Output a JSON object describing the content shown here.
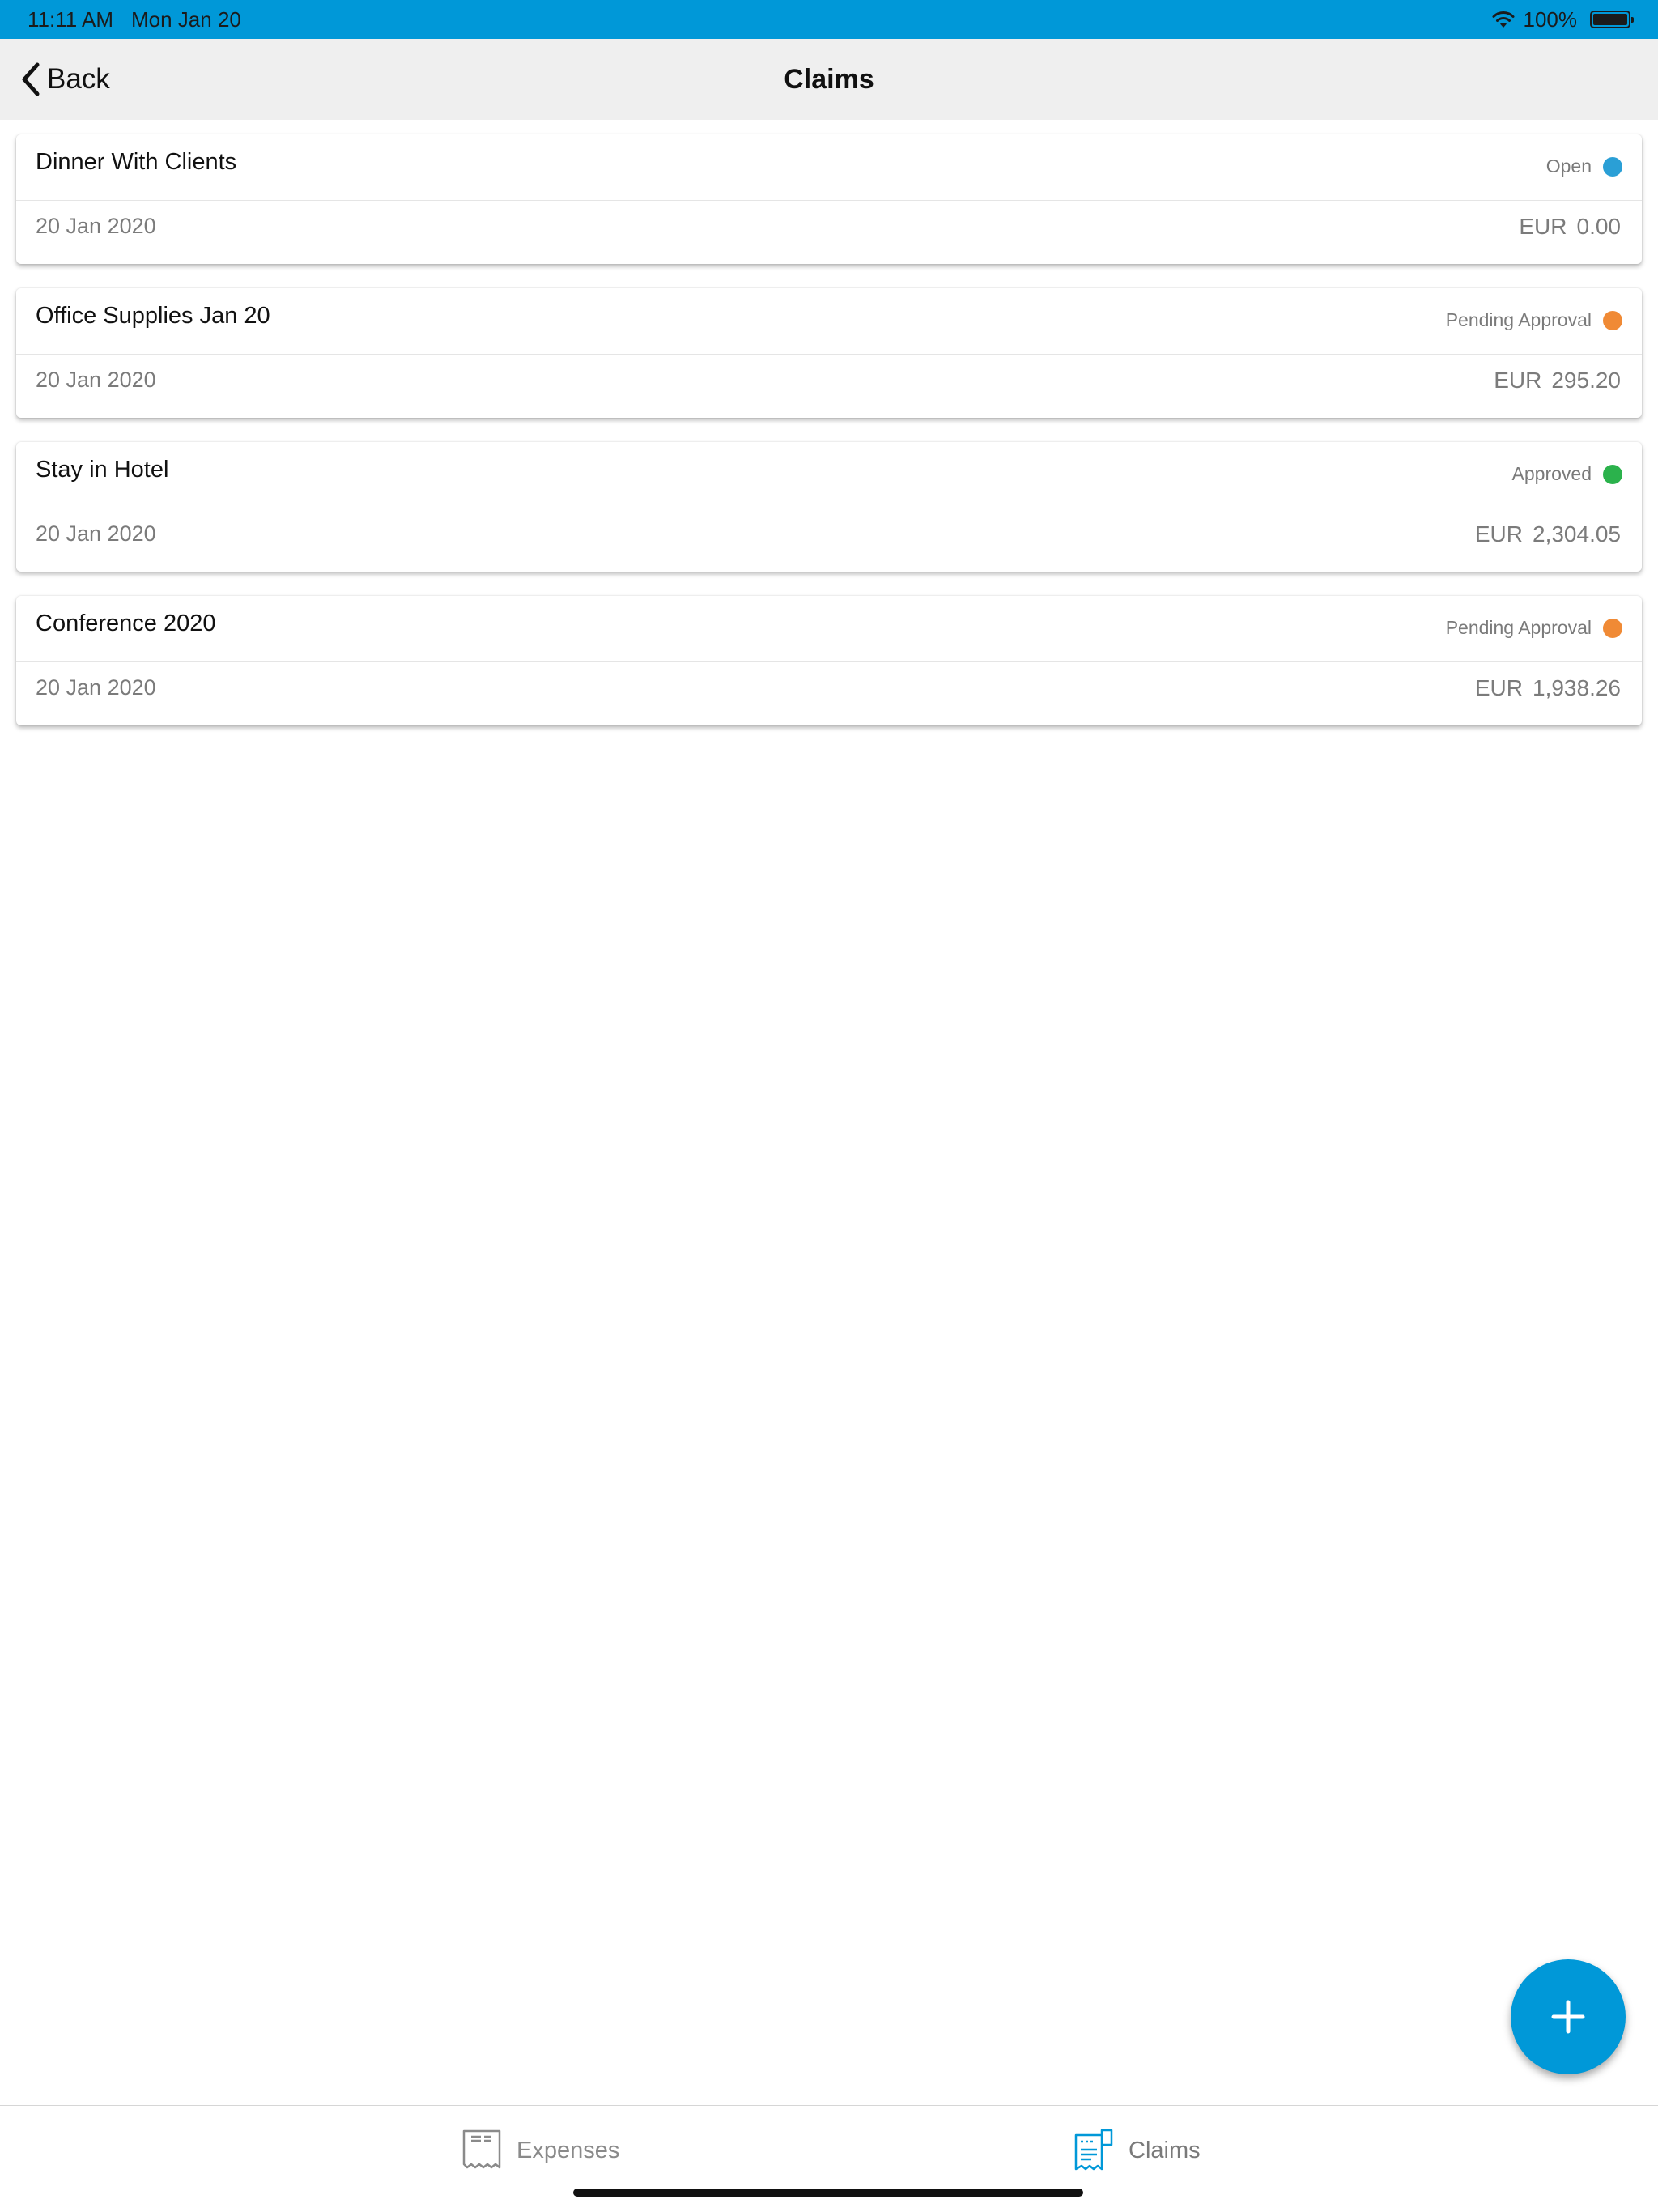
{
  "status_bar": {
    "time": "11:11 AM",
    "date": "Mon Jan 20",
    "battery_percent": "100%",
    "battery_level": 1.0
  },
  "nav": {
    "back_label": "Back",
    "title": "Claims"
  },
  "claims": [
    {
      "title": "Dinner With Clients",
      "status": "Open",
      "status_color": "#2a9fd6",
      "date": "20 Jan 2020",
      "currency": "EUR",
      "amount": "0.00"
    },
    {
      "title": "Office Supplies Jan 20",
      "status": "Pending Approval",
      "status_color": "#f08a35",
      "date": "20 Jan 2020",
      "currency": "EUR",
      "amount": "295.20"
    },
    {
      "title": "Stay in Hotel",
      "status": "Approved",
      "status_color": "#2bb24c",
      "date": "20 Jan 2020",
      "currency": "EUR",
      "amount": "2,304.05"
    },
    {
      "title": "Conference 2020",
      "status": "Pending Approval",
      "status_color": "#f08a35",
      "date": "20 Jan 2020",
      "currency": "EUR",
      "amount": "1,938.26"
    }
  ],
  "tabs": {
    "expenses_label": "Expenses",
    "claims_label": "Claims"
  },
  "colors": {
    "accent": "#0098d8",
    "nav_background": "#efefef"
  },
  "icons": {
    "wifi": "wifi-icon",
    "battery": "battery-icon",
    "back": "chevron-left-icon",
    "add": "plus-icon",
    "expenses": "receipt-icon",
    "claims": "claim-document-icon"
  }
}
